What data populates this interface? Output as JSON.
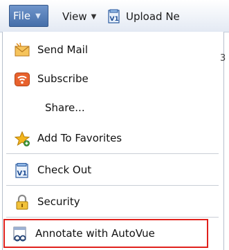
{
  "toolbar": {
    "file_label": "File",
    "view_label": "View",
    "upload_label": "Upload Ne"
  },
  "behind_text": "3",
  "menu": {
    "items": [
      {
        "label": "Send Mail",
        "icon": "envelope-icon"
      },
      {
        "label": "Subscribe",
        "icon": "subscribe-icon"
      },
      {
        "label": "Share...",
        "icon": ""
      },
      {
        "label": "Add To Favorites",
        "icon": "favorites-star-icon"
      },
      {
        "label": "Check Out",
        "icon": "check-out-icon"
      },
      {
        "label": "Security",
        "icon": "lock-icon"
      },
      {
        "label": "Annotate with AutoVue",
        "icon": "autovue-annotate-icon",
        "highlighted": true
      }
    ]
  },
  "colors": {
    "file_button": "#466fa9",
    "highlight_border": "#e0201b",
    "separator": "#c9ced6"
  }
}
